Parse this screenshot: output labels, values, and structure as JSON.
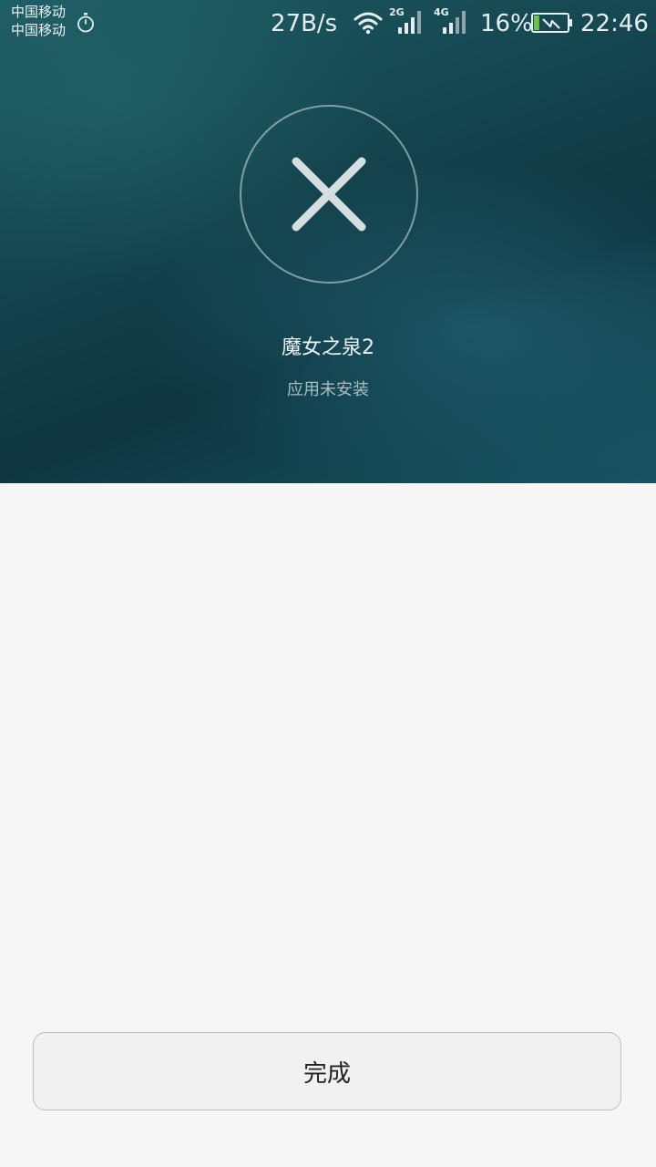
{
  "status_bar": {
    "carrier_1": "中国移动",
    "carrier_2": "中国移动",
    "stopwatch_icon": "stopwatch-icon",
    "net_speed": "27B/s",
    "wifi_icon": "wifi-icon",
    "sim1_network": "2G",
    "sim2_network": "4G",
    "battery_percent": "16%",
    "battery_level": 0.16,
    "battery_charging": true,
    "time": "22:46"
  },
  "result": {
    "icon": "close-icon",
    "app_name": "魔女之泉2",
    "message": "应用未安装"
  },
  "footer": {
    "done_label": "完成"
  },
  "colors": {
    "hero_dark": "#0e3540",
    "hero_teal": "#1c5a62",
    "background": "#f6f6f7",
    "battery_green": "#6dc24b"
  }
}
